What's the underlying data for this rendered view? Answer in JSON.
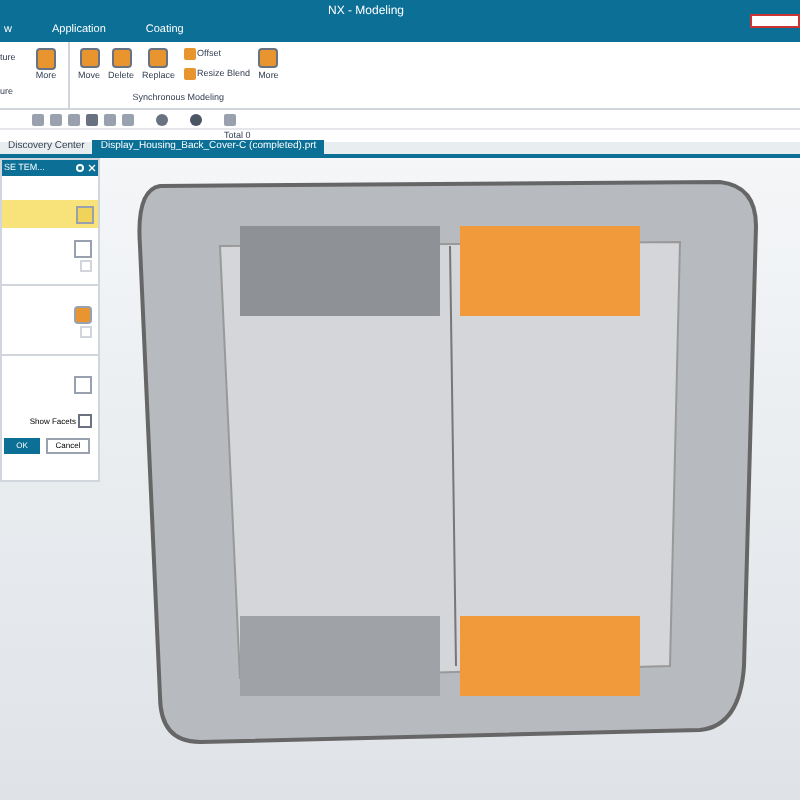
{
  "window": {
    "title": "NX - Modeling"
  },
  "ribbon_tabs": [
    {
      "label": "w",
      "selected": false
    },
    {
      "label": "Application",
      "selected": false
    },
    {
      "label": "Coating",
      "selected": false
    }
  ],
  "ribbon": {
    "left_labels": [
      "ture",
      "ure"
    ],
    "more_label": "More",
    "buttons": [
      {
        "label": "Move",
        "kind": "large"
      },
      {
        "label": "Delete",
        "kind": "large"
      },
      {
        "label": "Replace",
        "kind": "large"
      },
      {
        "label": "Offset",
        "kind": "small"
      },
      {
        "label": "Resize Blend",
        "kind": "small"
      },
      {
        "label": "More",
        "kind": "large"
      }
    ],
    "group_label": "Synchronous Modeling"
  },
  "selection_status": "Total 0",
  "doc_tabs": [
    {
      "label": "Discovery Center",
      "selected": false
    },
    {
      "label": "Display_Housing_Back_Cover-C (completed).prt",
      "selected": true
    }
  ],
  "dialog": {
    "title": "SE TEM...",
    "show_facets": "Show Facets",
    "buttons": [
      "OK",
      "Cancel"
    ]
  }
}
